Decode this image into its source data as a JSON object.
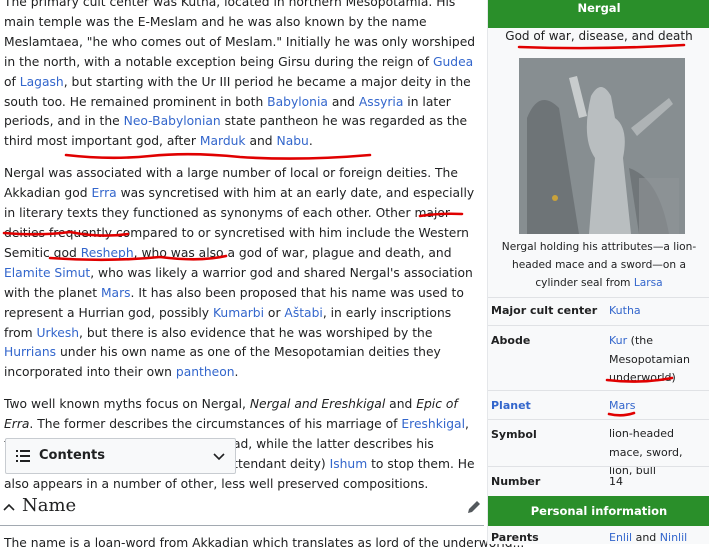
{
  "article": {
    "p1": {
      "line0": "The primary cult center was Kutha, located in northern Mesopotamia. His main temple was",
      "t1": "the E-Meslam and he was also known by the name Meslamtaea, \"he who comes out of Meslam.\" Initially he was only worshiped in the north, with a notable exception being Girsu during the reign of ",
      "gudea": "Gudea",
      "t2": " of ",
      "lagash": "Lagash",
      "t3": ", but starting with the Ur III period he became a major deity in the south too. He remained prominent in both ",
      "babylonia": "Babylonia",
      "t4": " and ",
      "assyria": "Assyria",
      "t5": " in later periods, and in the ",
      "neobab": "Neo-Babylonian",
      "t6": " state pantheon he was regarded as the third most important god, after ",
      "marduk": "Marduk",
      "t7": " and ",
      "nabu": "Nabu",
      "t8": "."
    },
    "p2": {
      "t1": "Nergal was associated with a large number of local or foreign deities. The Akkadian god ",
      "erra": "Erra",
      "t2": " was syncretised with him at an early date, and especially in literary texts they functioned as synonyms of each other. Other major deities frequently compared to or syncretised with him include the Western Semitic god ",
      "resheph": "Resheph",
      "t3": ", who was also a god of war, plague and death, and ",
      "simut": "Elamite Simut",
      "t4": ", who was likely a warrior god and shared Nergal's association with the planet ",
      "mars": "Mars",
      "t5": ". It has also been proposed that his name was used to represent a Hurrian god, possibly ",
      "kumarbi": "Kumarbi",
      "t6": " or ",
      "astabi": "Aštabi",
      "t7": ", in early inscriptions from ",
      "urkesh": "Urkesh",
      "t8": ", but there is also evidence that he was worshiped by the ",
      "hurrians": "Hurrians",
      "t9": " under his own name as one of the Mesopotamian deities they incorporated into their own ",
      "pantheon": "pantheon",
      "t10": "."
    },
    "p3": {
      "t1": "Two well known myths focus on Nergal, ",
      "myth1": "Nergal and Ereshkigal",
      "t2": " and ",
      "myth2": "Epic of Erra",
      "t3": ". The former describes the circumstances of his marriage of ",
      "ereshkigal": "Ereshkigal",
      "t4": ", the Mesopotamian goddess of the dead, while the latter describes his rampages and efforts of his ",
      "sukkal": "sukkal",
      "t5": " (attendant deity) ",
      "ishum": "Ishum",
      "t6": " to stop them. He also appears in a number of other, less well preserved compositions."
    },
    "toc_label": "Contents",
    "section_heading": "Name",
    "next_line": "The name is a loan-word from Akkadian which translates as lord of the underworld..."
  },
  "infobox": {
    "title": "Nergal",
    "subtitle": "God of war, disease, and death",
    "caption_text": "Nergal holding his attributes—a lion-headed mace and a sword—on a cylinder seal from ",
    "caption_link": "Larsa",
    "rows": {
      "cult_center": {
        "label": "Major cult center",
        "value": "Kutha"
      },
      "abode": {
        "label": "Abode",
        "value_link": "Kur",
        "value_text": " (the Mesopotamian underworld)"
      },
      "planet": {
        "label": "Planet",
        "value": "Mars"
      },
      "symbol": {
        "label": "Symbol",
        "value": "lion-headed mace, sword, lion, bull"
      },
      "number": {
        "label": "Number",
        "value": "14"
      },
      "parents": {
        "label": "Parents",
        "value_link1": "Enlil",
        "value_and": " and ",
        "value_link2": "Ninlil"
      }
    },
    "personal_header": "Personal information"
  },
  "colors": {
    "link": "#3366cc",
    "infobox_header": "#2a8f2a",
    "annotation": "#e00000"
  }
}
